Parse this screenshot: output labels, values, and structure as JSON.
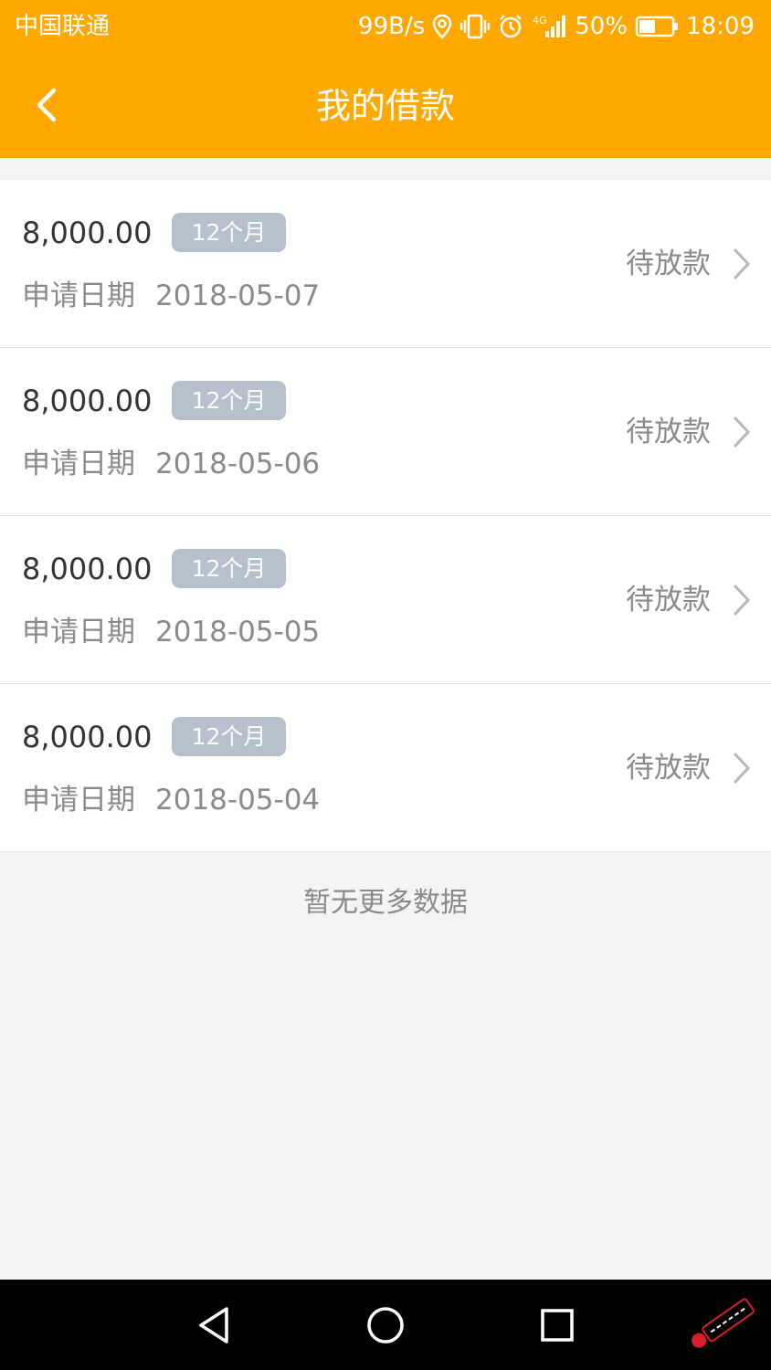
{
  "status_bar": {
    "carrier": "中国联通",
    "network_speed": "99B/s",
    "network_type": "4G",
    "battery_percent": "50%",
    "battery_level": 0.5,
    "time": "18:09",
    "icons": [
      "location-icon",
      "vibrate-icon",
      "alarm-icon",
      "signal-icon",
      "battery-icon"
    ]
  },
  "header": {
    "title": "我的借款",
    "back_icon": "chevron-left-icon"
  },
  "loans": [
    {
      "amount": "8,000.00",
      "term": "12个月",
      "date_label": "申请日期",
      "date": "2018-05-07",
      "status": "待放款"
    },
    {
      "amount": "8,000.00",
      "term": "12个月",
      "date_label": "申请日期",
      "date": "2018-05-06",
      "status": "待放款"
    },
    {
      "amount": "8,000.00",
      "term": "12个月",
      "date_label": "申请日期",
      "date": "2018-05-05",
      "status": "待放款"
    },
    {
      "amount": "8,000.00",
      "term": "12个月",
      "date_label": "申请日期",
      "date": "2018-05-04",
      "status": "待放款"
    }
  ],
  "footer_text": "暂无更多数据",
  "colors": {
    "primary": "#ffa800",
    "badge": "#b6c0cc",
    "page_background": "#f4f4f4",
    "secondary_text": "#8a8a8a"
  },
  "system_nav": {
    "icons": [
      "back-triangle-icon",
      "home-circle-icon",
      "recents-square-icon"
    ]
  }
}
